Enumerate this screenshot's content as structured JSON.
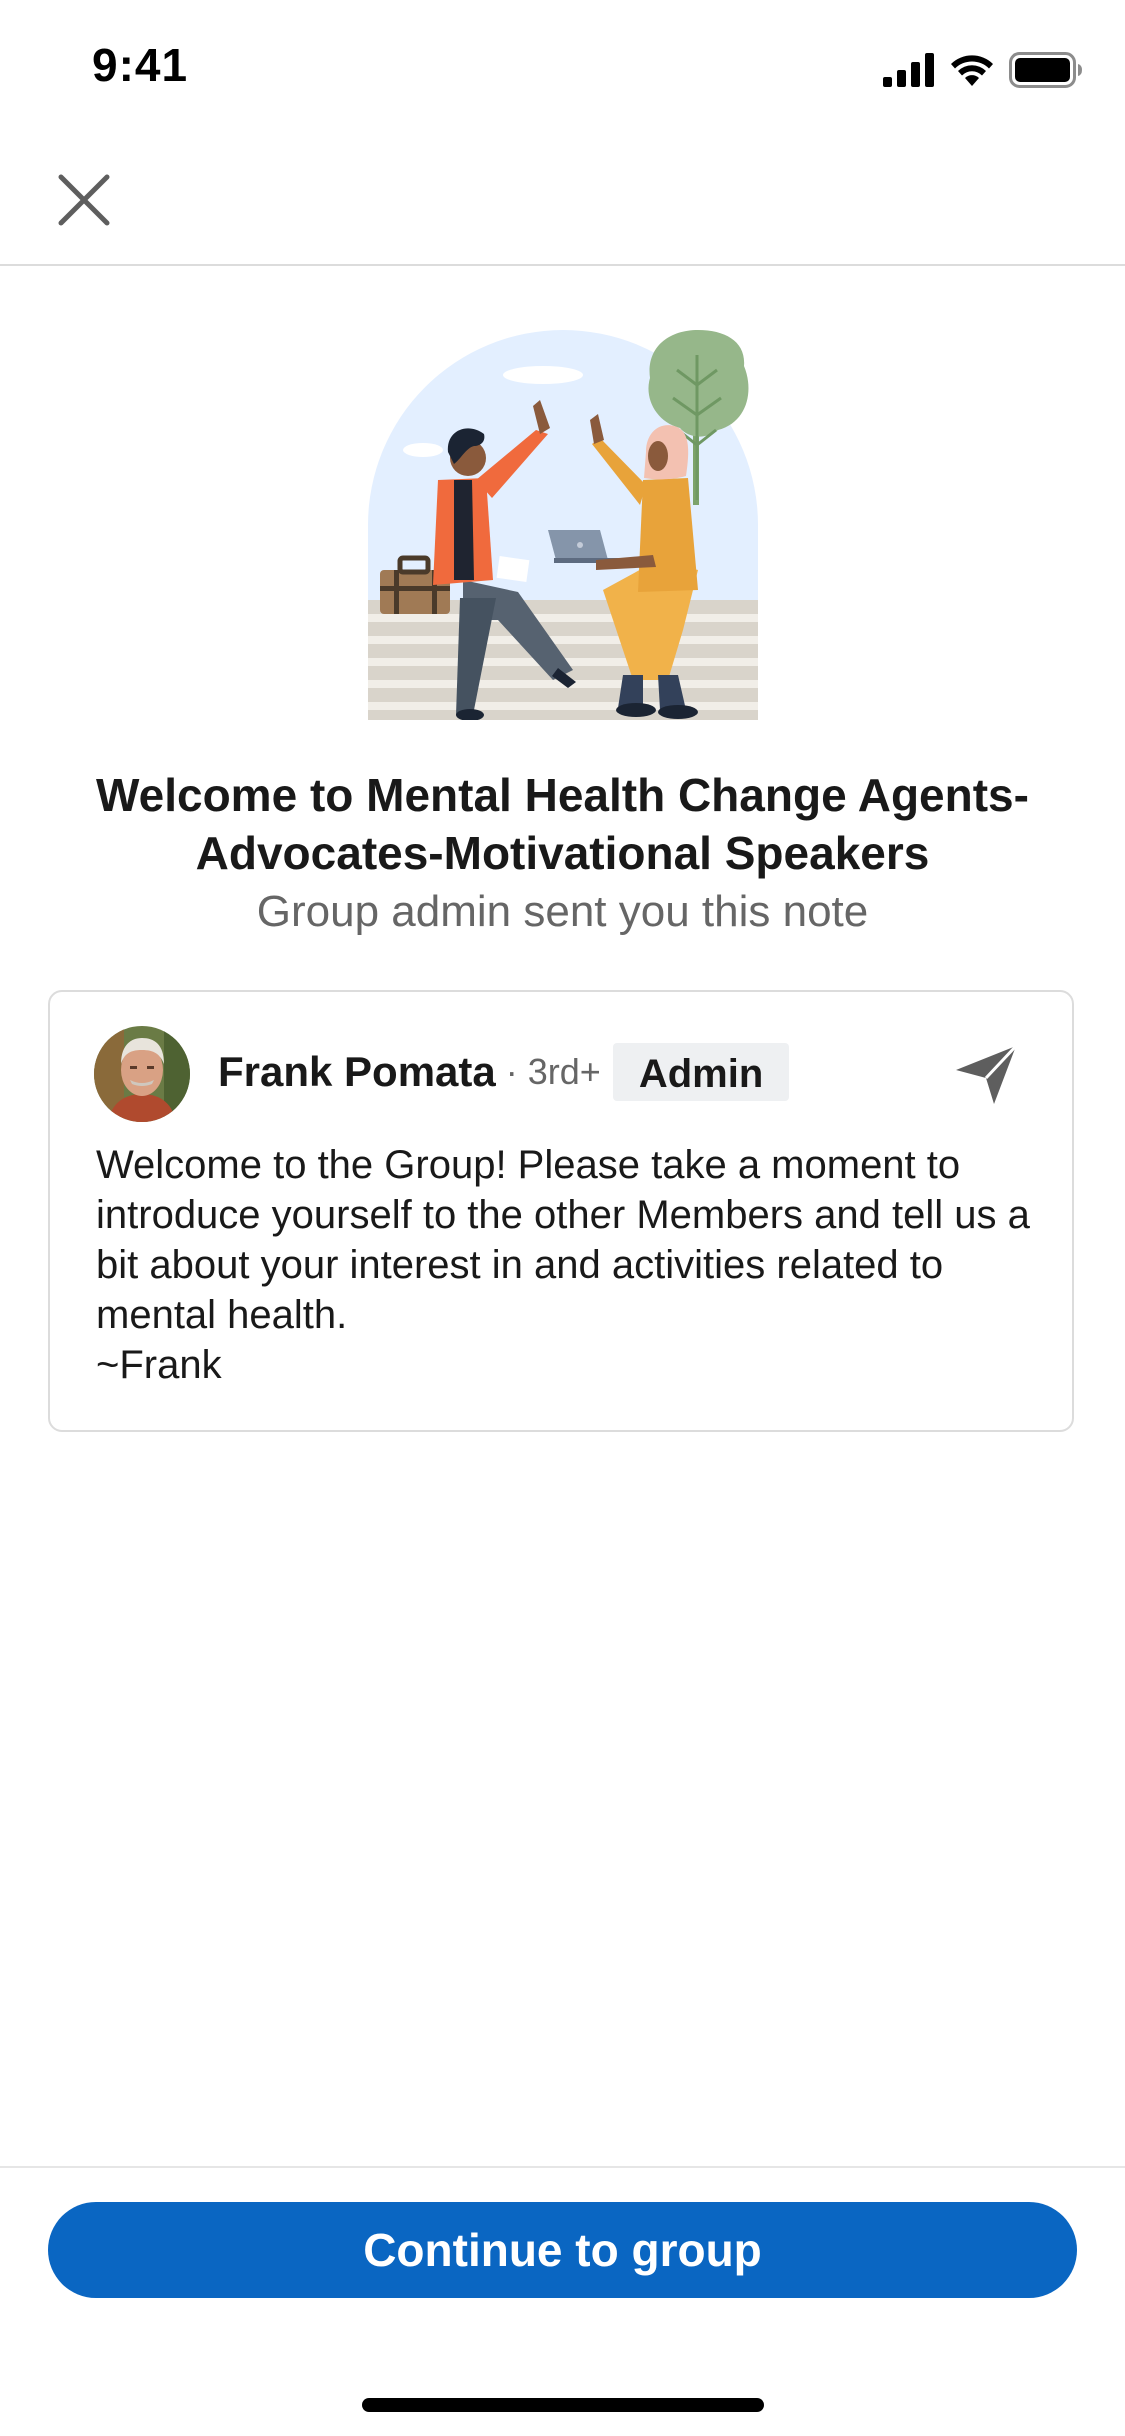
{
  "status_bar": {
    "time": "9:41",
    "icons": [
      "cellular-signal-icon",
      "wifi-icon",
      "battery-icon"
    ]
  },
  "header": {
    "close_icon": "close-icon"
  },
  "illustration": {
    "name": "people-high-five-illustration"
  },
  "welcome": {
    "title": "Welcome to Mental Health Change Agents-Advocates-Motivational Speakers",
    "subtitle": "Group admin sent you this note"
  },
  "note": {
    "author_name": "Frank Pomata",
    "author_degree": "· 3rd+",
    "author_badge": "Admin",
    "send_icon": "send-icon",
    "body": "Welcome to the Group!  Please take a moment to introduce yourself to the other Members and tell us a bit about your interest in and activities related to mental health.\n~Frank"
  },
  "footer": {
    "continue_label": "Continue to group"
  },
  "colors": {
    "primary": "#0a66c2",
    "text": "#191919",
    "muted": "#666666",
    "divider": "#dcdcdc"
  }
}
